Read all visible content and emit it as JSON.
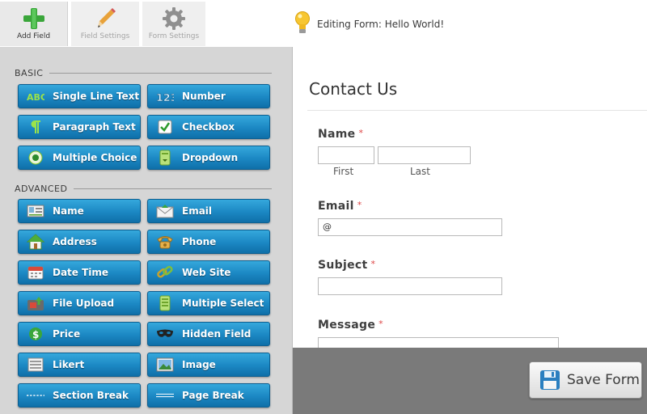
{
  "tabs": [
    {
      "label": "Add Field",
      "icon": "plus-icon"
    },
    {
      "label": "Field Settings",
      "icon": "pencil-icon"
    },
    {
      "label": "Form Settings",
      "icon": "gear-icon"
    }
  ],
  "editing_notice": {
    "icon": "lightbulb-icon",
    "text": "Editing Form: Hello World!"
  },
  "palette": {
    "basic_heading": "BASIC",
    "basic_fields": [
      {
        "label": "Single Line Text",
        "icon": "abc-text-icon"
      },
      {
        "label": "Number",
        "icon": "number-123-icon"
      },
      {
        "label": "Paragraph Text",
        "icon": "pilcrow-icon"
      },
      {
        "label": "Checkbox",
        "icon": "checkbox-icon"
      },
      {
        "label": "Multiple Choice",
        "icon": "radio-icon"
      },
      {
        "label": "Dropdown",
        "icon": "dropdown-icon"
      }
    ],
    "advanced_heading": "ADVANCED",
    "advanced_fields": [
      {
        "label": "Name",
        "icon": "name-card-icon"
      },
      {
        "label": "Email",
        "icon": "envelope-icon"
      },
      {
        "label": "Address",
        "icon": "house-icon"
      },
      {
        "label": "Phone",
        "icon": "phone-icon"
      },
      {
        "label": "Date Time",
        "icon": "calendar-icon"
      },
      {
        "label": "Web Site",
        "icon": "chain-link-icon"
      },
      {
        "label": "File Upload",
        "icon": "file-upload-icon"
      },
      {
        "label": "Multiple Select",
        "icon": "multi-select-icon"
      },
      {
        "label": "Price",
        "icon": "dollar-icon"
      },
      {
        "label": "Hidden Field",
        "icon": "mask-icon"
      },
      {
        "label": "Likert",
        "icon": "likert-grid-icon"
      },
      {
        "label": "Image",
        "icon": "image-icon"
      },
      {
        "label": "Section Break",
        "icon": "dashed-line-icon"
      },
      {
        "label": "Page Break",
        "icon": "page-break-icon"
      }
    ]
  },
  "form": {
    "title": "Contact Us",
    "required_mark": "*",
    "name": {
      "label": "Name",
      "first": "First",
      "last": "Last"
    },
    "email": {
      "label": "Email",
      "value": "@"
    },
    "subject": {
      "label": "Subject"
    },
    "message": {
      "label": "Message"
    }
  },
  "save_button": {
    "label": "Save Form",
    "icon": "floppy-disk-icon"
  },
  "colors": {
    "field_button": "#1b87c3",
    "required": "#dd4444",
    "bottom_bar": "#7a7a7a"
  }
}
